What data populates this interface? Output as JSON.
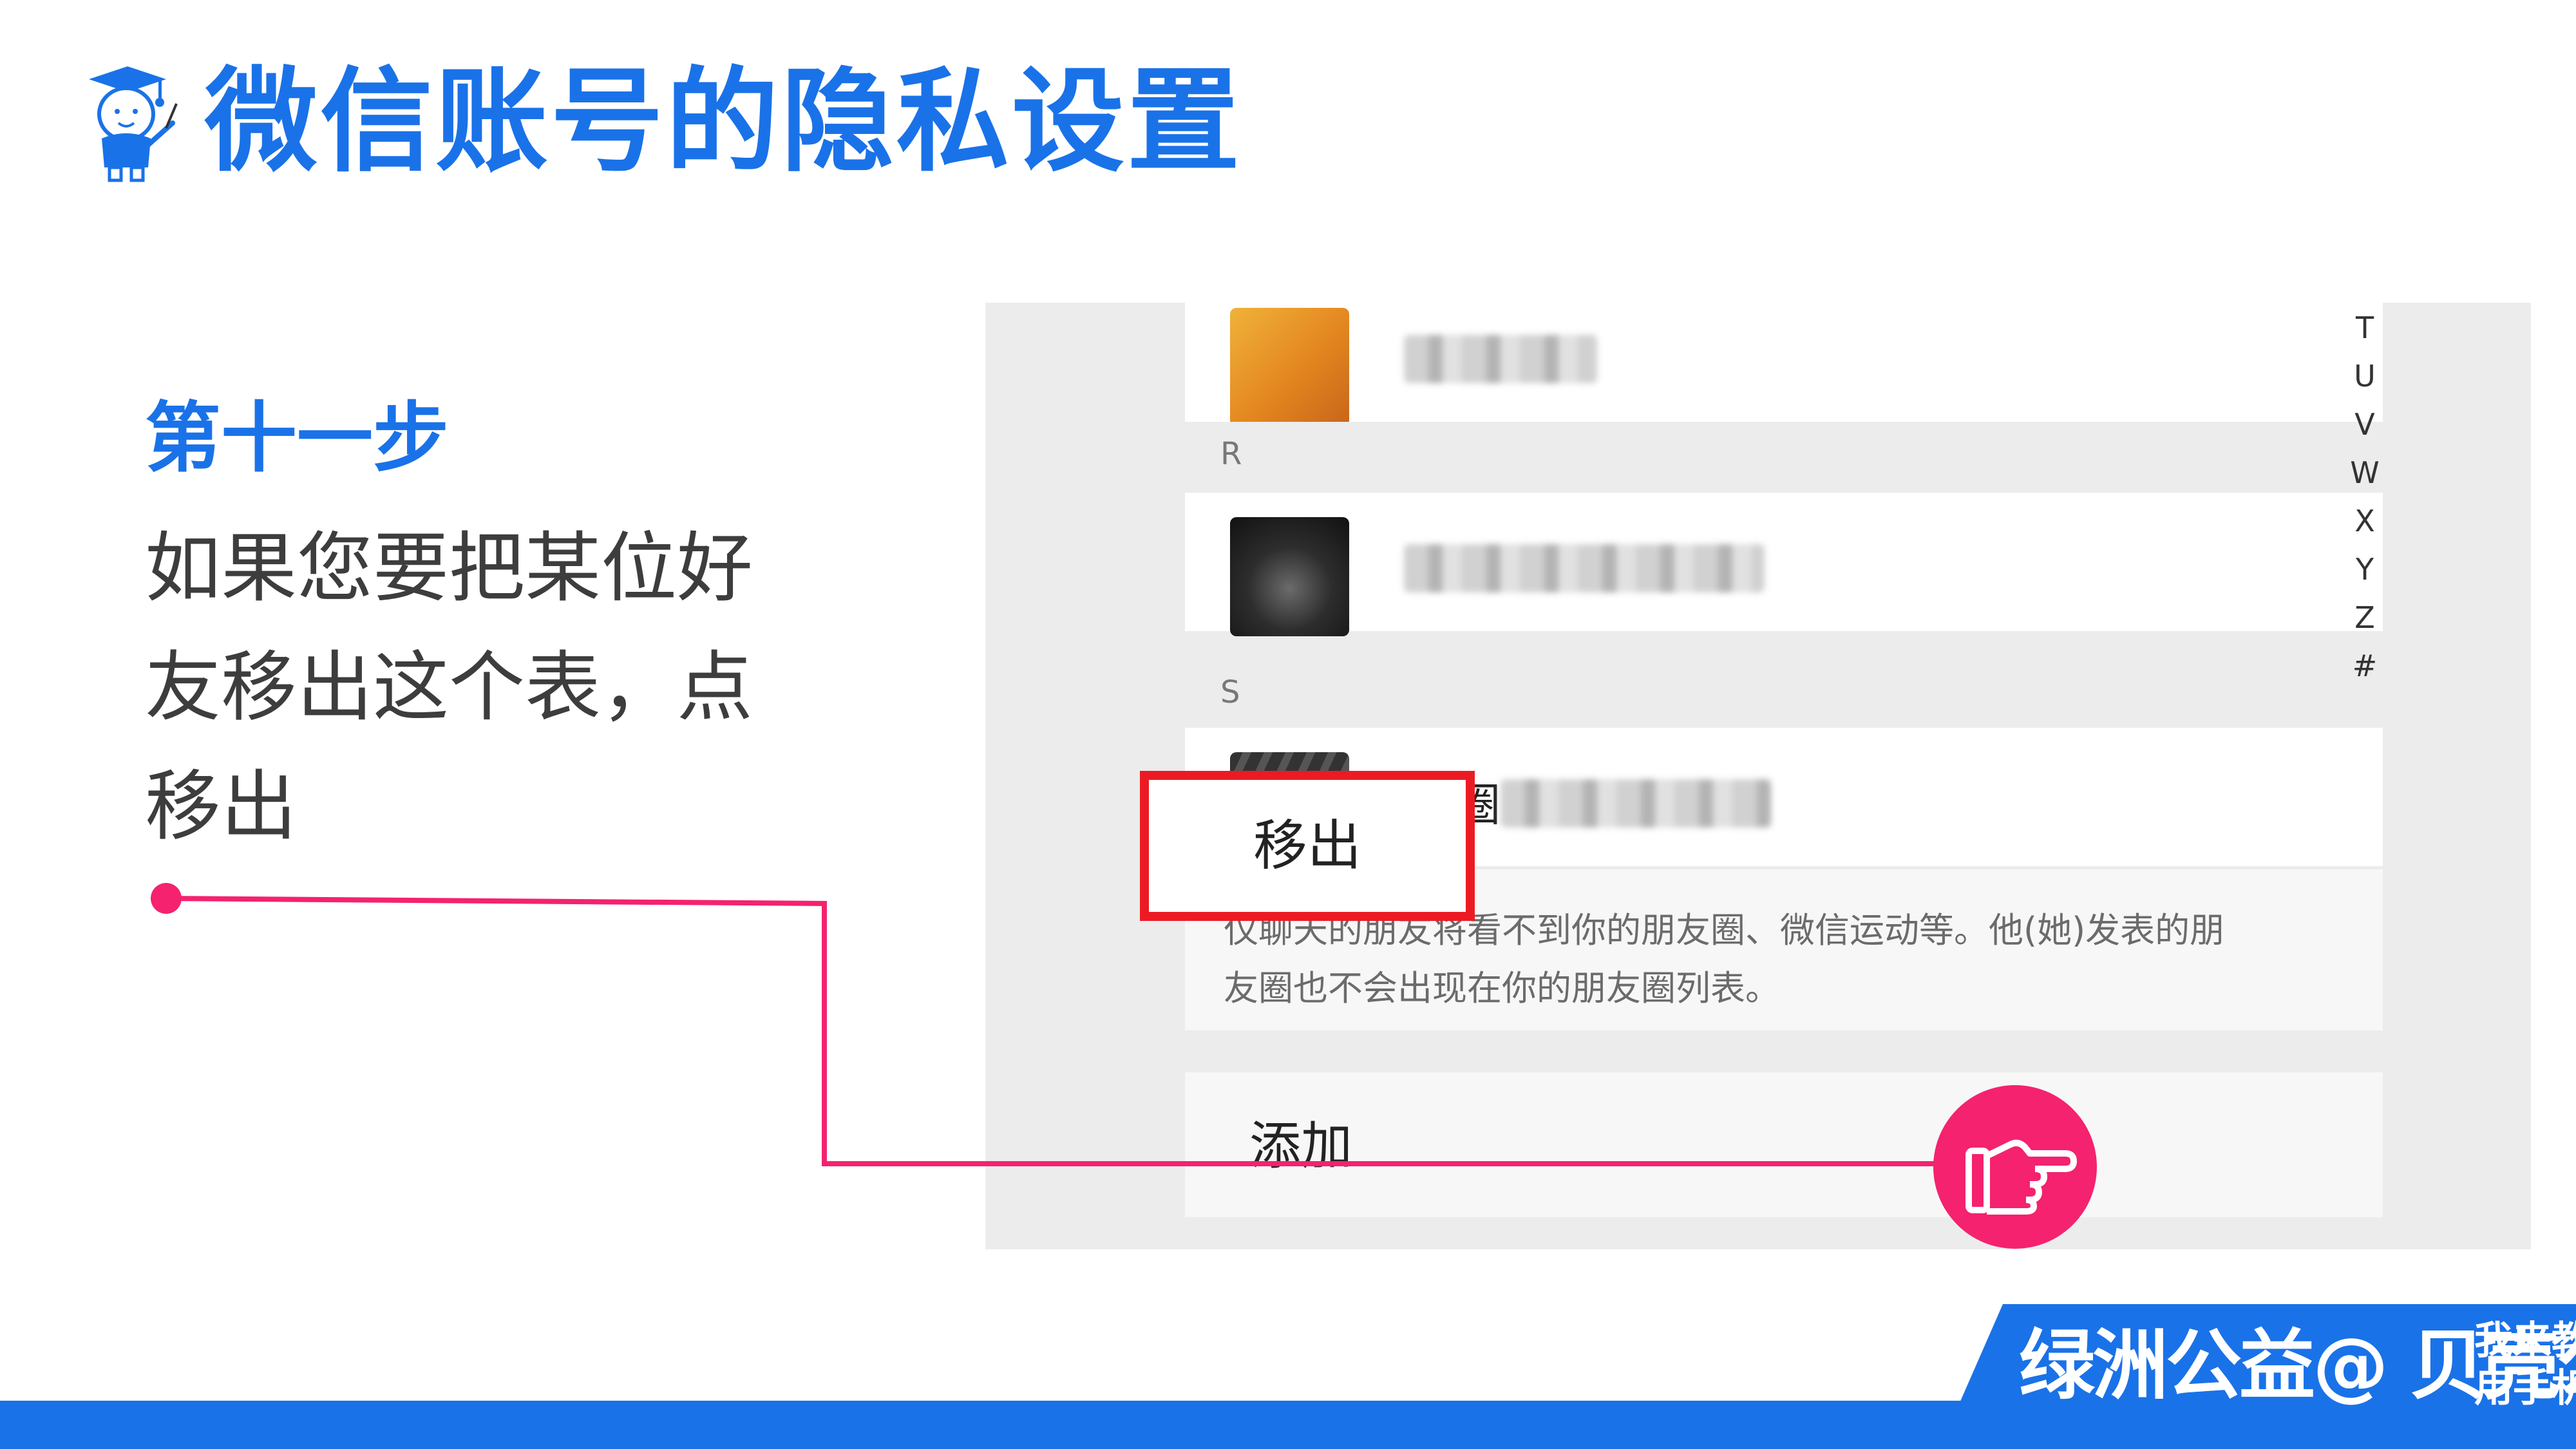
{
  "page": {
    "title": "微信账号的隐私设置",
    "accent_color": "#1a72e8",
    "highlight_color": "#ec1b23",
    "pointer_color": "#f4226f"
  },
  "step": {
    "heading": "第十一步",
    "lines": [
      "如果您要把某位好",
      "友移出这个表，点",
      "移出"
    ]
  },
  "phone": {
    "sections": {
      "r": "R",
      "s": "S"
    },
    "contacts": [
      {
        "avatar": "orange-image-avatar",
        "name_visible": ""
      },
      {
        "avatar": "hooded-person-avatar",
        "name_visible": ""
      },
      {
        "avatar": "hands-avatar",
        "name_visible": "闵圈"
      }
    ],
    "index_letters": [
      "T",
      "U",
      "V",
      "W",
      "X",
      "Y",
      "Z",
      "#"
    ],
    "info_line1": "仅聊天的朋友将看不到你的朋友圈、微信运动等。他(她)发表的朋",
    "info_line2": "友圈也不会出现在你的朋友圈列表。",
    "add_label": "添加",
    "remove_label": "移出"
  },
  "footer": {
    "brand": "绿洲公益@ 贝壳公益",
    "slogan_line1": "我来教您",
    "slogan_line2": "用手机"
  }
}
